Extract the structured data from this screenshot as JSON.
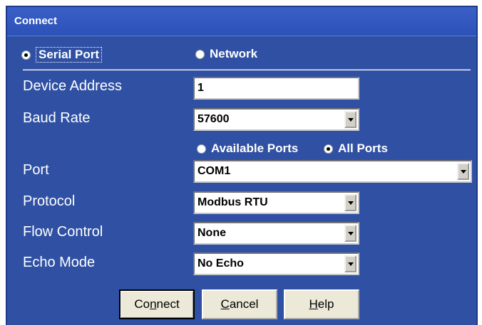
{
  "window": {
    "title": "Connect"
  },
  "connection": {
    "serial_label": "Serial Port",
    "network_label": "Network"
  },
  "fields": {
    "device_address": {
      "label": "Device Address",
      "value": "1"
    },
    "baud_rate": {
      "label": "Baud Rate",
      "value": "57600"
    },
    "port_filter": {
      "available_label": "Available Ports",
      "all_label": "All Ports"
    },
    "port": {
      "label": "Port",
      "value": "COM1"
    },
    "protocol": {
      "label": "Protocol",
      "value": "Modbus RTU"
    },
    "flow_control": {
      "label": "Flow Control",
      "value": "None"
    },
    "echo_mode": {
      "label": "Echo Mode",
      "value": "No Echo"
    }
  },
  "buttons": {
    "connect": {
      "pre": "Co",
      "u": "n",
      "post": "nect"
    },
    "cancel": {
      "pre": "",
      "u": "C",
      "post": "ancel"
    },
    "help": {
      "pre": "",
      "u": "H",
      "post": "elp"
    }
  }
}
